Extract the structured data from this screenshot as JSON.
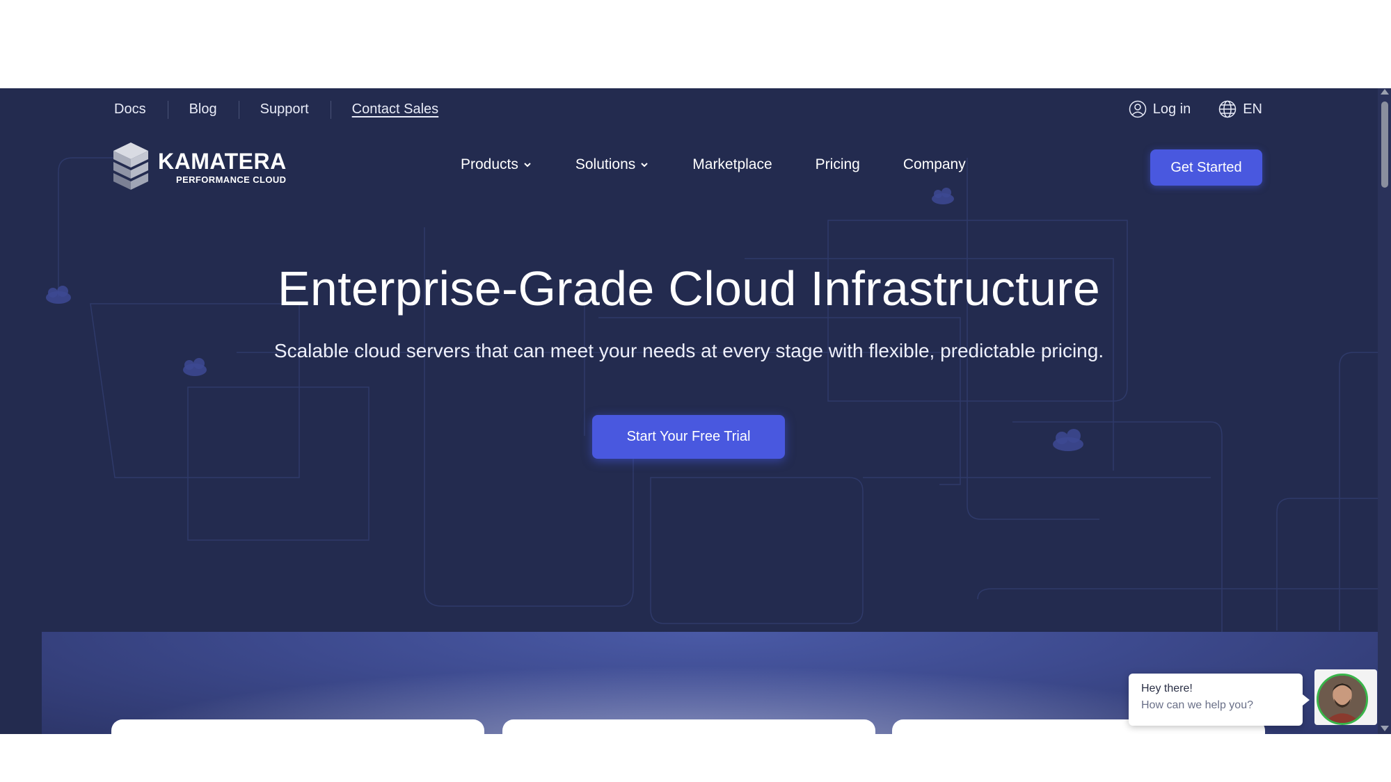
{
  "topbar": {
    "links": [
      "Docs",
      "Blog",
      "Support",
      "Contact Sales"
    ],
    "login_label": "Log in",
    "language_label": "EN"
  },
  "header": {
    "logo_name": "KAMATERA",
    "logo_sub": "PERFORMANCE CLOUD",
    "nav": [
      "Products",
      "Solutions",
      "Marketplace",
      "Pricing",
      "Company"
    ],
    "cta_label": "Get Started"
  },
  "hero": {
    "title": "Enterprise-Grade Cloud Infrastructure",
    "subtitle": "Scalable cloud servers that can meet your needs at every stage with flexible, predictable pricing.",
    "cta_label": "Start Your Free Trial"
  },
  "chat": {
    "title": "Hey there!",
    "message": "How can we help you?"
  },
  "colors": {
    "background": "#232b4f",
    "accent": "#4958df"
  }
}
